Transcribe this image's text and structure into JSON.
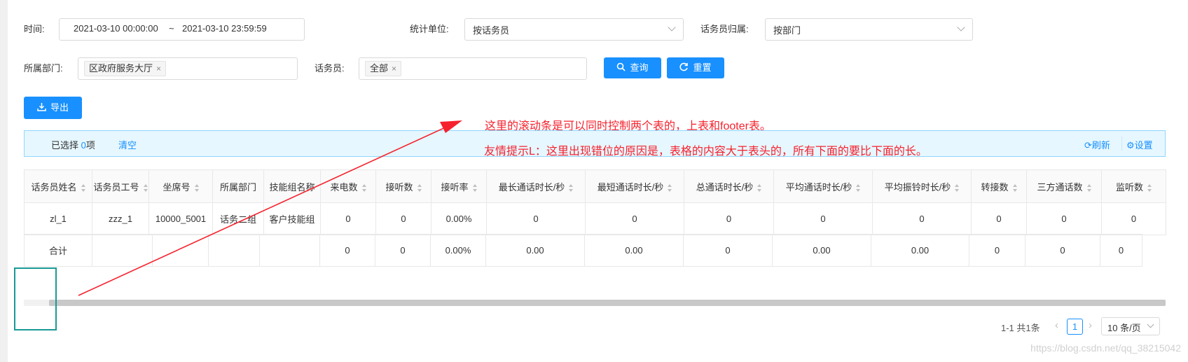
{
  "filters": {
    "time_label": "时间:",
    "time_start": "2021-03-10 00:00:00",
    "time_sep": "~",
    "time_end": "2021-03-10 23:59:59",
    "stat_unit_label": "统计单位:",
    "stat_unit_value": "按话务员",
    "operator_group_label": "话务员归属:",
    "operator_group_value": "按部门",
    "department_label": "所属部门:",
    "department_tag": "区政府服务大厅",
    "operator_label": "话务员:",
    "operator_tag": "全部"
  },
  "buttons": {
    "query": "查询",
    "reset": "重置",
    "export": "导出"
  },
  "selection_bar": {
    "selected_prefix": "已选择",
    "selected_count": "0",
    "selected_suffix": "项",
    "clear": "清空",
    "refresh": "刷新",
    "settings": "设置"
  },
  "annotations": {
    "line1": "这里的滚动条是可以同时控制两个表的，上表和footer表。",
    "line2": "友情提示L：这里出现错位的原因是，表格的内容大于表头的，所有下面的要比下面的长。"
  },
  "table": {
    "headers": [
      "话务员姓名",
      "话务员工号",
      "坐席号",
      "所属部门",
      "技能组名称",
      "来电数",
      "接听数",
      "接听率",
      "最长通话时长/秒",
      "最短通话时长/秒",
      "总通话时长/秒",
      "平均通话时长/秒",
      "平均振铃时长/秒",
      "转接数",
      "三方通话数",
      "监听数"
    ],
    "rows": [
      [
        "zl_1",
        "zzz_1",
        "10000_5001",
        "话务二组",
        "客户技能组",
        "0",
        "0",
        "0.00%",
        "0",
        "0",
        "0",
        "0",
        "0",
        "0",
        "0",
        "0"
      ]
    ],
    "footer": [
      "合计",
      "",
      "",
      "",
      "",
      "0",
      "0",
      "0.00%",
      "0.00",
      "0.00",
      "0",
      "0.00",
      "0.00",
      "0",
      "0",
      "0"
    ]
  },
  "pagination": {
    "summary": "1-1 共1条",
    "current_page": "1",
    "page_size": "10 条/页"
  },
  "watermark": "https://blog.csdn.net/qq_38215042",
  "colors": {
    "primary": "#1890ff",
    "annotation": "#f5222d",
    "highlight_box": "#1a9a96"
  }
}
